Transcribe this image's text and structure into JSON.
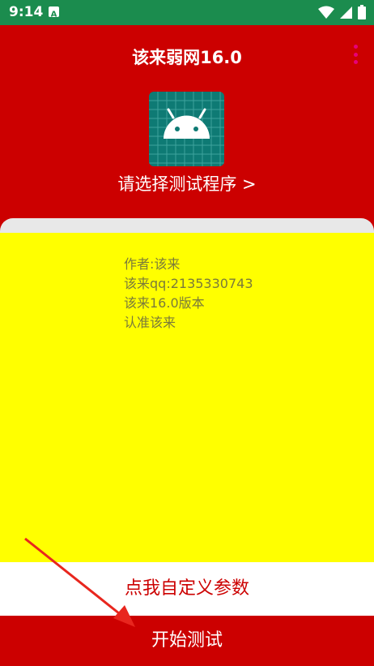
{
  "status_bar": {
    "time": "9:14",
    "notification_icon": "a-notification-icon",
    "wifi_icon": "wifi-icon",
    "signal_icon": "signal-icon",
    "battery_icon": "battery-icon"
  },
  "header": {
    "title": "该来弱网16.0",
    "menu_icon": "more-vert-icon"
  },
  "app_icon": "android-icon",
  "select_program": {
    "label": "请选择测试程序 >"
  },
  "info": {
    "lines": [
      "作者:该来",
      "该来qq:2135330743",
      "该来16.0版本",
      "认准该来"
    ]
  },
  "buttons": {
    "custom_params": "点我自定义参数",
    "start_test": "开始测试"
  },
  "colors": {
    "status_bar": "#1B8C4E",
    "primary": "#CC0000",
    "panel": "#FFFF00",
    "accent": "#E6007A",
    "icon_bg": "#0E7A74"
  }
}
